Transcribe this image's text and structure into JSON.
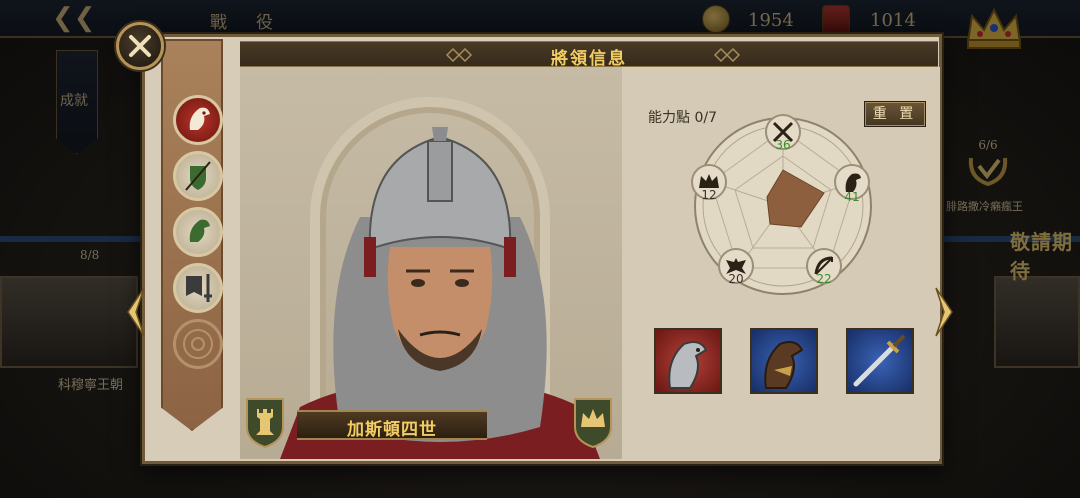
{
  "background": {
    "screen_title": "戰　役",
    "coins": "1954",
    "glory": "1014",
    "achievement_label": "成就",
    "campaign_level": "8/8",
    "campaign_name": "科穆寧王朝",
    "right_label": "敬請期待",
    "quest_count": "6/6",
    "quest_label": "腓路撒冷癩瘋王"
  },
  "panel": {
    "title": "將領信息",
    "close_icon": "close-icon",
    "sidebar": {
      "items": [
        {
          "icon": "horse-head-emblem-icon",
          "active": true
        },
        {
          "icon": "shield-spear-icon",
          "active": false
        },
        {
          "icon": "knight-helmet-icon",
          "active": false
        },
        {
          "icon": "sword-banner-icon",
          "active": false
        },
        {
          "icon": "locked-slot-icon",
          "active": false
        }
      ]
    },
    "general": {
      "name": "加斯頓四世",
      "left_badge_icon": "rook-tower-icon",
      "right_badge_icon": "crown-icon"
    },
    "abilities": {
      "points_label": "能力點 0/7",
      "reset_label": "重 置",
      "stats": [
        {
          "name": "infantry",
          "icon": "crossed-swords-icon",
          "value": "36",
          "color": "#3c8a2e"
        },
        {
          "name": "cavalry",
          "icon": "horse-icon",
          "value": "41",
          "color": "#3c8a2e"
        },
        {
          "name": "archery",
          "icon": "bow-icon",
          "value": "22",
          "color": "#3c8a2e"
        },
        {
          "name": "navy",
          "icon": "eagle-icon",
          "value": "20",
          "color": "#3a3128"
        },
        {
          "name": "politics",
          "icon": "crown-icon",
          "value": "12",
          "color": "#3a3128"
        }
      ]
    },
    "equipment": [
      {
        "icon": "armored-horse-icon",
        "frame": "#8e2a24"
      },
      {
        "icon": "war-horse-icon",
        "frame": "#1f3f7e"
      },
      {
        "icon": "sword-icon",
        "frame": "#1f3f7e"
      }
    ],
    "prev_icon": "chevron-left-icon",
    "next_icon": "chevron-right-icon"
  }
}
